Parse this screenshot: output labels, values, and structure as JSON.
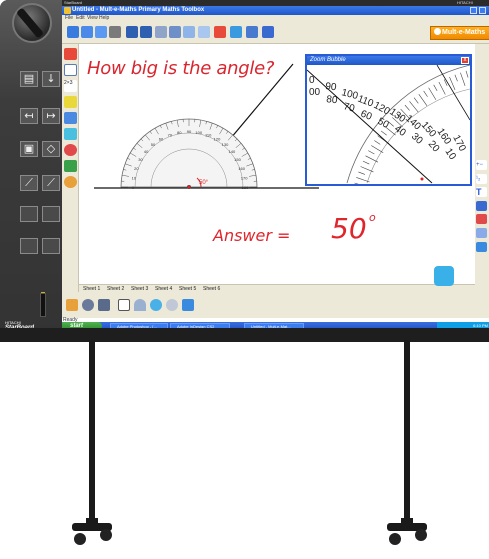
{
  "board": {
    "brand_top": "StarBoard",
    "brand_top_right": "HITACHI",
    "brand_bottom_small": "HITACHI",
    "brand_bottom": "StarBoard"
  },
  "window": {
    "title": "Untitled - Mult-e-Maths Primary Maths Toolbox",
    "menus": [
      "File",
      "Edit",
      "View",
      "Help"
    ],
    "mm_button_label": "Mult-e-Maths"
  },
  "canvas": {
    "question": "How big is the angle?",
    "answer_label": "Answer =",
    "answer_value": "50",
    "answer_unit": "o",
    "protractor_reading": "50°",
    "protractor_ticks": [
      "0",
      "10",
      "20",
      "30",
      "40",
      "50",
      "60",
      "70",
      "80",
      "90",
      "100",
      "110",
      "120",
      "130",
      "140",
      "150",
      "160",
      "170",
      "180"
    ]
  },
  "zoom_bubble": {
    "title": "Zoom Bubble",
    "close": "x",
    "outer_scale": [
      "0",
      "90",
      "100",
      "110",
      "120",
      "130",
      "140",
      "150",
      "160",
      "170"
    ],
    "inner_scale": [
      "00",
      "80",
      "70",
      "60",
      "50",
      "40",
      "30",
      "20",
      "10"
    ]
  },
  "sheets": [
    "Sheet 1",
    "Sheet 2",
    "Sheet 3",
    "Sheet 4",
    "Sheet 5",
    "Sheet 6"
  ],
  "status": {
    "ready": "Ready"
  },
  "taskbar": {
    "start": "start",
    "items": [
      "Adobe Photoshop - [...",
      "Adobe InDesign CS2",
      "Untitled - Mult-e-Mat..."
    ],
    "clock": "6:10 PM"
  },
  "colors": {
    "ink_red": "#e0252c",
    "title_blue": "#2a5bd6",
    "toolbar_bg": "#ece9d8",
    "accent_orange": "#f39a00"
  }
}
